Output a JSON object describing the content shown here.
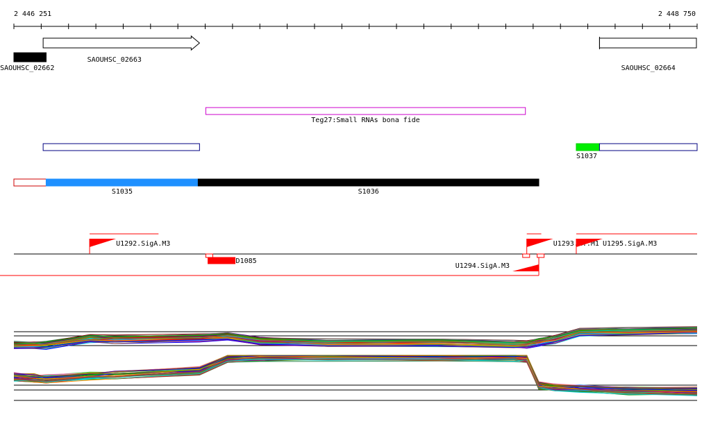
{
  "ruler": {
    "start_label": "2 446 251",
    "end_label": "2 448 750",
    "start": 2446251,
    "end": 2448750
  },
  "genes": [
    {
      "id": "gene-saouhsc-02662",
      "label": "SAOUHSC_02662",
      "start": 2446251,
      "end": 2446369,
      "strand": "-",
      "fill": "#000000"
    },
    {
      "id": "gene-saouhsc-02663",
      "label": "SAOUHSC_02663",
      "start": 2446358,
      "end": 2446930,
      "strand": "+",
      "fill": "#ffffff"
    },
    {
      "id": "gene-saouhsc-02664",
      "label": "SAOUHSC_02664",
      "start": 2448393,
      "end": 2448750,
      "strand": "+",
      "fill": "#ffffff"
    }
  ],
  "srna": {
    "label": "Teg27:Small RNAs bona fide",
    "start": 2446953,
    "end": 2448122,
    "color": "#cc00cc"
  },
  "segments_row1": [
    {
      "id": "segment-blue-left",
      "start": 2446358,
      "end": 2446930,
      "stroke": "#000080",
      "fill": "#ffffff",
      "label": ""
    },
    {
      "id": "segment-s1037",
      "start": 2448308,
      "end": 2448393,
      "stroke": "#00cc00",
      "fill": "#00ee00",
      "label": "S1037"
    },
    {
      "id": "segment-blue-right",
      "start": 2448393,
      "end": 2448750,
      "stroke": "#000080",
      "fill": "#ffffff",
      "label": ""
    }
  ],
  "segments_row2": [
    {
      "id": "segment-red-outline",
      "start": 2446251,
      "end": 2446369,
      "stroke": "#cc0000",
      "fill": "#ffffff",
      "label": ""
    },
    {
      "id": "segment-s1035",
      "start": 2446369,
      "end": 2446925,
      "stroke": "#1e90ff",
      "fill": "#1e90ff",
      "label": "S1035"
    },
    {
      "id": "segment-s1036",
      "start": 2446925,
      "end": 2448171,
      "stroke": "#000000",
      "fill": "#000000",
      "label": "S1036"
    }
  ],
  "promoters": [
    {
      "id": "promoter-u1292",
      "label": "U1292.SigA.M3",
      "pos": 2446528,
      "dir": "right",
      "side": "top",
      "line_to": 2446780
    },
    {
      "id": "promoter-u1293",
      "label": "U1293.M..M1",
      "pos": 2448127,
      "dir": "right",
      "side": "top",
      "line_to": 2448180
    },
    {
      "id": "promoter-u1295",
      "label": "U1295.SigA.M3",
      "pos": 2448308,
      "dir": "right",
      "side": "top",
      "line_to": 2448750
    },
    {
      "id": "promoter-u1294",
      "label": "U1294.SigA.M3",
      "pos": 2448171,
      "dir": "left",
      "side": "bottom",
      "line_to": 2446251
    }
  ],
  "features_on_line": [
    {
      "id": "feature-d1085",
      "label": "D1085",
      "start": 2446961,
      "end": 2447060,
      "fill": "#ff0000"
    }
  ],
  "colors": {
    "accent_red": "#ff0000",
    "srna_magenta": "#cc00cc",
    "segment_blue": "#1e90ff",
    "segment_green": "#00ee00",
    "outline_navy": "#000080"
  },
  "chart_data": {
    "type": "line",
    "title": "",
    "xlabel": "",
    "ylabel": "",
    "x": [
      2446251,
      2446325,
      2446369,
      2446530,
      2446620,
      2446930,
      2447033,
      2447150,
      2447400,
      2447800,
      2448080,
      2448127,
      2448171,
      2448230,
      2448320,
      2448500,
      2448750
    ],
    "panels": [
      {
        "name": "",
        "series_count": 40,
        "center": [
          1.0,
          1.0,
          1.0,
          1.4,
          1.35,
          1.45,
          1.55,
          1.25,
          1.15,
          1.15,
          1.05,
          1.05,
          1.2,
          1.35,
          1.8,
          1.85,
          1.9
        ],
        "spread": 0.45
      },
      {
        "name": "",
        "series_count": 40,
        "center": [
          1.4,
          1.35,
          1.3,
          1.45,
          1.5,
          1.7,
          2.3,
          2.35,
          2.35,
          2.35,
          2.35,
          2.3,
          1.0,
          0.9,
          0.85,
          0.75,
          0.7
        ],
        "spread": 0.35
      }
    ],
    "palette": [
      "#ff0000",
      "#00a000",
      "#0000ff",
      "#ff8c00",
      "#8b008b",
      "#00ced1",
      "#808000",
      "#a0522d",
      "#ff69b4",
      "#32cd32",
      "#1e90ff",
      "#b8860b",
      "#800000",
      "#4b0082",
      "#2e8b57",
      "#696969"
    ]
  }
}
